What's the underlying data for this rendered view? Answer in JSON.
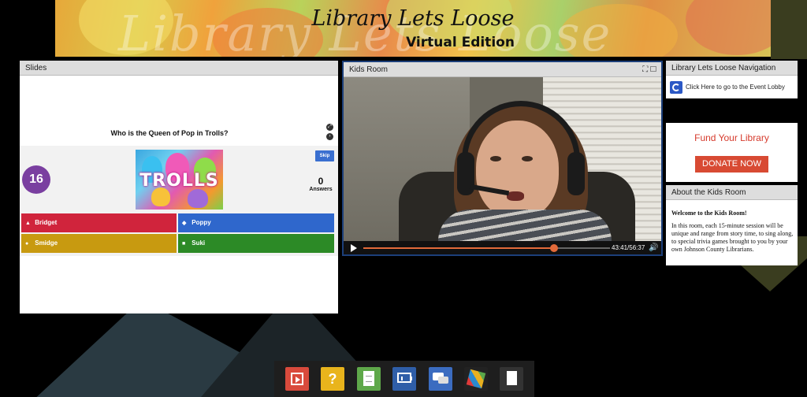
{
  "banner": {
    "title": "Library Lets Loose",
    "subtitle": "Virtual Edition",
    "watermark": "Library Lets Loose"
  },
  "slides": {
    "header": "Slides",
    "question": "Who is the Queen of Pop in Trolls?",
    "timer": "16",
    "image_text": "TROLLS",
    "skip_label": "Skip",
    "answer_count": "0",
    "answer_label": "Answers",
    "answers": [
      {
        "symbol": "▲",
        "label": "Bridget",
        "color": "#d0243c"
      },
      {
        "symbol": "◆",
        "label": "Poppy",
        "color": "#2f67cc"
      },
      {
        "symbol": "●",
        "label": "Smidge",
        "color": "#c89a10"
      },
      {
        "symbol": "■",
        "label": "Suki",
        "color": "#2c8a26"
      }
    ]
  },
  "kids_room": {
    "header": "Kids Room",
    "time_readout": "43:41/56:37",
    "progress_fraction": 0.7716
  },
  "navigation": {
    "header": "Library Lets Loose Navigation",
    "lobby_link": "Click Here to go to the Event Lobby"
  },
  "fund": {
    "title": "Fund Your Library",
    "button": "DONATE NOW"
  },
  "about": {
    "header": "About the Kids Room",
    "heading": "Welcome to the Kids Room!",
    "body": "In this room, each 15-minute session will be unique and range from story time, to sing along, to special trivia games brought to you by your own Johnson County Librarians."
  },
  "toolbar": {
    "icons": [
      "video-icon",
      "question-icon",
      "document-icon",
      "presentation-icon",
      "chat-icon",
      "mosaic-icon",
      "page-icon"
    ],
    "question_glyph": "?"
  },
  "colors": {
    "accent_purple": "#7a3fa0",
    "donate_red": "#d84a33",
    "progress_orange": "#e36a3a"
  }
}
